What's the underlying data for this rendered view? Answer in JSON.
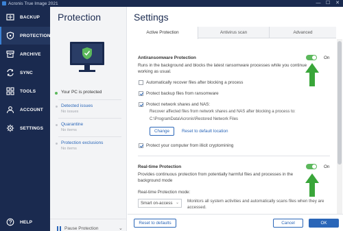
{
  "window": {
    "title": "Acronis True Image 2021",
    "controls": [
      "—",
      "☐",
      "✕"
    ]
  },
  "sidebar": {
    "items": [
      {
        "label": "BACKUP",
        "icon": "backup-icon"
      },
      {
        "label": "PROTECTION",
        "icon": "shield-icon",
        "active": true
      },
      {
        "label": "ARCHIVE",
        "icon": "archive-icon"
      },
      {
        "label": "SYNC",
        "icon": "sync-icon"
      },
      {
        "label": "TOOLS",
        "icon": "tools-icon"
      },
      {
        "label": "ACCOUNT",
        "icon": "account-icon"
      },
      {
        "label": "SETTINGS",
        "icon": "gear-icon"
      }
    ],
    "help_label": "HELP"
  },
  "protection": {
    "title": "Protection",
    "status": "Your PC is protected",
    "links": [
      {
        "label": "Detected issues",
        "sub": "No issues"
      },
      {
        "label": "Quarantine",
        "sub": "No items"
      },
      {
        "label": "Protection exclusions",
        "sub": "No items"
      }
    ],
    "pause_label": "Pause Protection"
  },
  "settings": {
    "title": "Settings",
    "tabs": [
      "Active Protection",
      "Antivirus scan",
      "Advanced"
    ],
    "active_tab": "Active Protection",
    "antiransomware": {
      "title": "Antiransomware Protection",
      "toggle_state": "On",
      "desc_line1": "Runs in the background and blocks the latest ransomware processes while you continue",
      "desc_line2": "working as usual.",
      "options": [
        {
          "label": "Automatically recover files after blocking a process",
          "checked": false
        },
        {
          "label": "Protect backup files from ransomware",
          "checked": true
        },
        {
          "label": "Protect network shares and NAS:",
          "checked": true
        }
      ],
      "recover_text": "Recover affected files from network shares and NAS after blocking a process to:",
      "recover_path": "C:\\ProgramData\\Acronis\\Restored Network Files",
      "change_label": "Change",
      "reset_location_label": "Reset to default location",
      "cryptomining_label": "Protect your computer from illicit cryptomining",
      "cryptomining_checked": true
    },
    "realtime": {
      "title": "Real-time Protection",
      "toggle_state": "On",
      "desc_line1": "Provides continuous protection from potentially harmful files and processes in the",
      "desc_line2": "background mode",
      "mode_label": "Real-time Protection mode:",
      "mode_value": "Smart on-access",
      "mode_desc_line1": "Monitors all system activities and automatically scans files when they are",
      "mode_desc_line2": "accessed."
    },
    "buttons": {
      "reset": "Reset to defaults",
      "cancel": "Cancel",
      "ok": "OK"
    }
  },
  "colors": {
    "sidebar_bg": "#1a2a4f",
    "accent": "#2a66b8",
    "toggle_on": "#5cb85c",
    "arrow_green": "#3aa63a"
  }
}
